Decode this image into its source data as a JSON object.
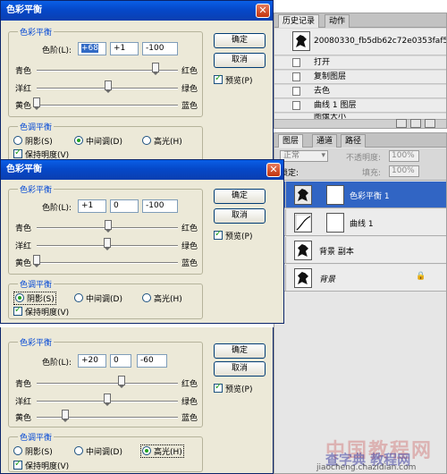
{
  "history_panel": {
    "tabs": [
      "历史记录",
      "动作"
    ],
    "snapshot_name": "20080330_fb5db62c72e0353faf5...",
    "items": [
      "打开",
      "复制图层",
      "去色",
      "曲线 1 图层",
      "图像大小"
    ]
  },
  "layers_panel": {
    "tabs": [
      "图层",
      "通道",
      "路径"
    ],
    "blend_mode": "正常",
    "opacity_label": "不透明度:",
    "opacity_value": "100%",
    "lock_label": "锁定:",
    "fill_label": "填充:",
    "fill_value": "100%",
    "layers": [
      {
        "name": "色彩平衡 1",
        "selected": true
      },
      {
        "name": "曲线 1",
        "selected": false
      },
      {
        "name": "背景 副本",
        "selected": false
      },
      {
        "name": "背景",
        "selected": false
      }
    ]
  },
  "dialogs": [
    {
      "title": "色彩平衡",
      "group_title": "色彩平衡",
      "levels_label": "色阶(L):",
      "levels": [
        "+68",
        "+1",
        "-100"
      ],
      "sliders": [
        {
          "left": "青色",
          "right": "红色",
          "value": 68
        },
        {
          "left": "洋红",
          "right": "绿色",
          "value": 1
        },
        {
          "left": "黄色",
          "right": "蓝色",
          "value": -100
        }
      ],
      "tone_title": "色调平衡",
      "tones": [
        "阴影(S)",
        "中间调(D)",
        "高光(H)"
      ],
      "tone_selected": 1,
      "preserve": "保持明度(V)",
      "ok": "确定",
      "cancel": "取消",
      "preview": "预览(P)"
    },
    {
      "title": "色彩平衡",
      "group_title": "色彩平衡",
      "levels_label": "色阶(L):",
      "levels": [
        "+1",
        "0",
        "-100"
      ],
      "sliders": [
        {
          "left": "青色",
          "right": "红色",
          "value": 1
        },
        {
          "left": "洋红",
          "right": "绿色",
          "value": 0
        },
        {
          "left": "黄色",
          "right": "蓝色",
          "value": -100
        }
      ],
      "tone_title": "色调平衡",
      "tones": [
        "阴影(S)",
        "中间调(D)",
        "高光(H)"
      ],
      "tone_selected": 0,
      "preserve": "保持明度(V)",
      "ok": "确定",
      "cancel": "取消",
      "preview": "预览(P)"
    },
    {
      "group_title": "色彩平衡",
      "levels_label": "色阶(L):",
      "levels": [
        "+20",
        "0",
        "-60"
      ],
      "sliders": [
        {
          "left": "青色",
          "right": "红色",
          "value": 20
        },
        {
          "left": "洋红",
          "right": "绿色",
          "value": 0
        },
        {
          "left": "黄色",
          "right": "蓝色",
          "value": -60
        }
      ],
      "tone_title": "色调平衡",
      "tones": [
        "阴影(S)",
        "中间调(D)",
        "高光(H)"
      ],
      "tone_selected": 2,
      "preserve": "保持明度(V)",
      "ok": "确定",
      "cancel": "取消",
      "preview": "预览(P)"
    }
  ],
  "watermark": {
    "brand": "中国教程网",
    "subtitle": "查字典 教程网",
    "url": "jiaocheng.chazidian.com"
  },
  "colors": {
    "dialog_bg": "#ECE9D8",
    "group_title": "#0046d5",
    "titlebar": "#0548c9",
    "selection": "#3165c4"
  }
}
